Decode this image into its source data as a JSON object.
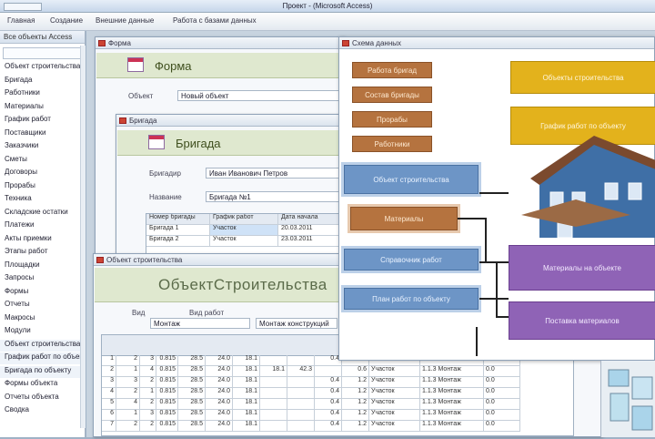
{
  "window": {
    "title": "Проект - (Microsoft Access)"
  },
  "ribbon": {
    "tabs": [
      "Главная",
      "Создание",
      "Внешние данные",
      "Работа с базами данных"
    ]
  },
  "nav": {
    "header": "Все объекты Access",
    "items": [
      "Объект строительства",
      "Бригада",
      "Работники",
      "Материалы",
      "График работ",
      "Поставщики",
      "Заказчики",
      "Сметы",
      "Договоры",
      "Прорабы",
      "Техника",
      "Складские остатки",
      "Платежи",
      "Акты приемки",
      "Этапы работ",
      "Площадки",
      "Запросы",
      "Формы",
      "Отчеты",
      "Макросы",
      "Модули",
      "Объект строительства",
      "График работ по объекту",
      "Бригада по объекту",
      "Формы объекта",
      "Отчеты объекта",
      "Сводка"
    ]
  },
  "form_window": {
    "title": "Форма",
    "header": "Форма",
    "label1": "Объект",
    "value1": "Новый объект"
  },
  "brigade_window": {
    "title": "Бригада",
    "header": "Бригада",
    "label1": "Бригадир",
    "value1": "Иван Иванович Петров",
    "label2": "Название",
    "value2": "Бригада №1",
    "cols": [
      "Номер бригады",
      "График работ",
      "Дата начала"
    ],
    "rows": [
      [
        "Бригада 1",
        "Участок",
        "20.03.2011"
      ],
      [
        "Бригада 2",
        "Участок",
        "23.03.2011"
      ]
    ]
  },
  "object_window": {
    "title": "Объект строительства",
    "header": "ОбъектСтроительства",
    "label1": "Вид",
    "label2": "Вид работ",
    "value1": "Монтаж",
    "value2": "Монтаж конструкций",
    "rows": [
      [
        "1",
        "2",
        "3",
        "0.815",
        "28.5",
        "24.0",
        "18.1",
        "",
        "",
        "0.4",
        "1.2",
        "Участок",
        "1.1.3 Монтаж",
        "0.0"
      ],
      [
        "2",
        "1",
        "4",
        "0.815",
        "28.5",
        "24.0",
        "18.1",
        "18.1",
        "42.3",
        "",
        "0.6",
        "Участок",
        "1.1.3 Монтаж",
        "0.0"
      ],
      [
        "3",
        "3",
        "2",
        "0.815",
        "28.5",
        "24.0",
        "18.1",
        "",
        "",
        "0.4",
        "1.2",
        "Участок",
        "1.1.3 Монтаж",
        "0.0"
      ],
      [
        "4",
        "2",
        "1",
        "0.815",
        "28.5",
        "24.0",
        "18.1",
        "",
        "",
        "0.4",
        "1.2",
        "Участок",
        "1.1.3 Монтаж",
        "0.0"
      ],
      [
        "5",
        "4",
        "2",
        "0.815",
        "28.5",
        "24.0",
        "18.1",
        "",
        "",
        "0.4",
        "1.2",
        "Участок",
        "1.1.3 Монтаж",
        "0.0"
      ],
      [
        "6",
        "1",
        "3",
        "0.815",
        "28.5",
        "24.0",
        "18.1",
        "",
        "",
        "0.4",
        "1.2",
        "Участок",
        "1.1.3 Монтаж",
        "0.0"
      ],
      [
        "7",
        "2",
        "2",
        "0.815",
        "28.5",
        "24.0",
        "18.1",
        "",
        "",
        "0.4",
        "1.2",
        "Участок",
        "1.1.3 Монтаж",
        "0.0"
      ]
    ]
  },
  "diagram": {
    "title": "Схема данных",
    "brown_boxes": [
      "Работа бригад",
      "Состав бригады",
      "Прорабы",
      "Работники"
    ],
    "blue_boxes": [
      "Объект строительства",
      "Справочник работ",
      "План работ по объекту"
    ],
    "brown_main": "Материалы",
    "yellow_boxes": [
      "Объекты строительства",
      "График работ по объекту"
    ],
    "purple_boxes": [
      "Материалы на объекте",
      "Поставка материалов"
    ]
  },
  "colors": {
    "brown": "#b5733f",
    "blue": "#6d95c6",
    "yellow": "#e3b21c",
    "purple": "#8f63b6",
    "header_green": "#dfe8cf"
  }
}
